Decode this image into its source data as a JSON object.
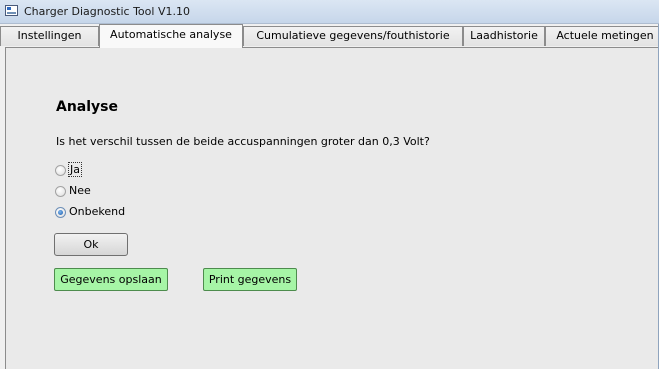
{
  "window": {
    "title": "Charger Diagnostic Tool V1.10"
  },
  "tabs": [
    {
      "label": "Instellingen",
      "active": false
    },
    {
      "label": "Automatische analyse",
      "active": true
    },
    {
      "label": "Cumulatieve gegevens/fouthistorie",
      "active": false
    },
    {
      "label": "Laadhistorie",
      "active": false
    },
    {
      "label": "Actuele metingen",
      "active": false
    }
  ],
  "analysis": {
    "heading": "Analyse",
    "question": "Is het verschil tussen de beide accuspanningen groter dan 0,3 Volt?",
    "options": [
      {
        "label": "Ja",
        "checked": false,
        "focused": true
      },
      {
        "label": "Nee",
        "checked": false,
        "focused": false
      },
      {
        "label": "Onbekend",
        "checked": true,
        "focused": false
      }
    ],
    "ok_label": "Ok"
  },
  "actions": {
    "save_label": "Gegevens opslaan",
    "print_label": "Print gegevens"
  },
  "colors": {
    "action_button_bg": "#a6f5a6",
    "titlebar": "#cfdbe9"
  }
}
